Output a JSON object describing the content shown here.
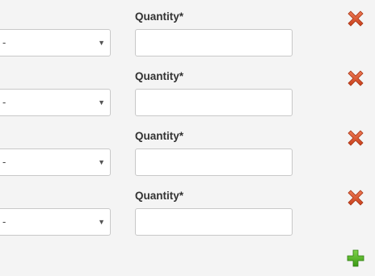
{
  "form": {
    "rows": [
      {
        "select_value": "-",
        "quantity_label": "Quantity",
        "required_mark": "*",
        "quantity_value": ""
      },
      {
        "select_value": "-",
        "quantity_label": "Quantity",
        "required_mark": "*",
        "quantity_value": ""
      },
      {
        "select_value": "-",
        "quantity_label": "Quantity",
        "required_mark": "*",
        "quantity_value": ""
      },
      {
        "select_value": "-",
        "quantity_label": "Quantity",
        "required_mark": "*",
        "quantity_value": ""
      }
    ],
    "icons": {
      "remove": "close-icon",
      "add": "plus-icon",
      "dropdown": "chevron-down-icon"
    },
    "colors": {
      "remove_icon": "#d9532c",
      "add_icon": "#4aab1f",
      "background": "#f4f4f4"
    },
    "caret_glyph": "▼"
  }
}
